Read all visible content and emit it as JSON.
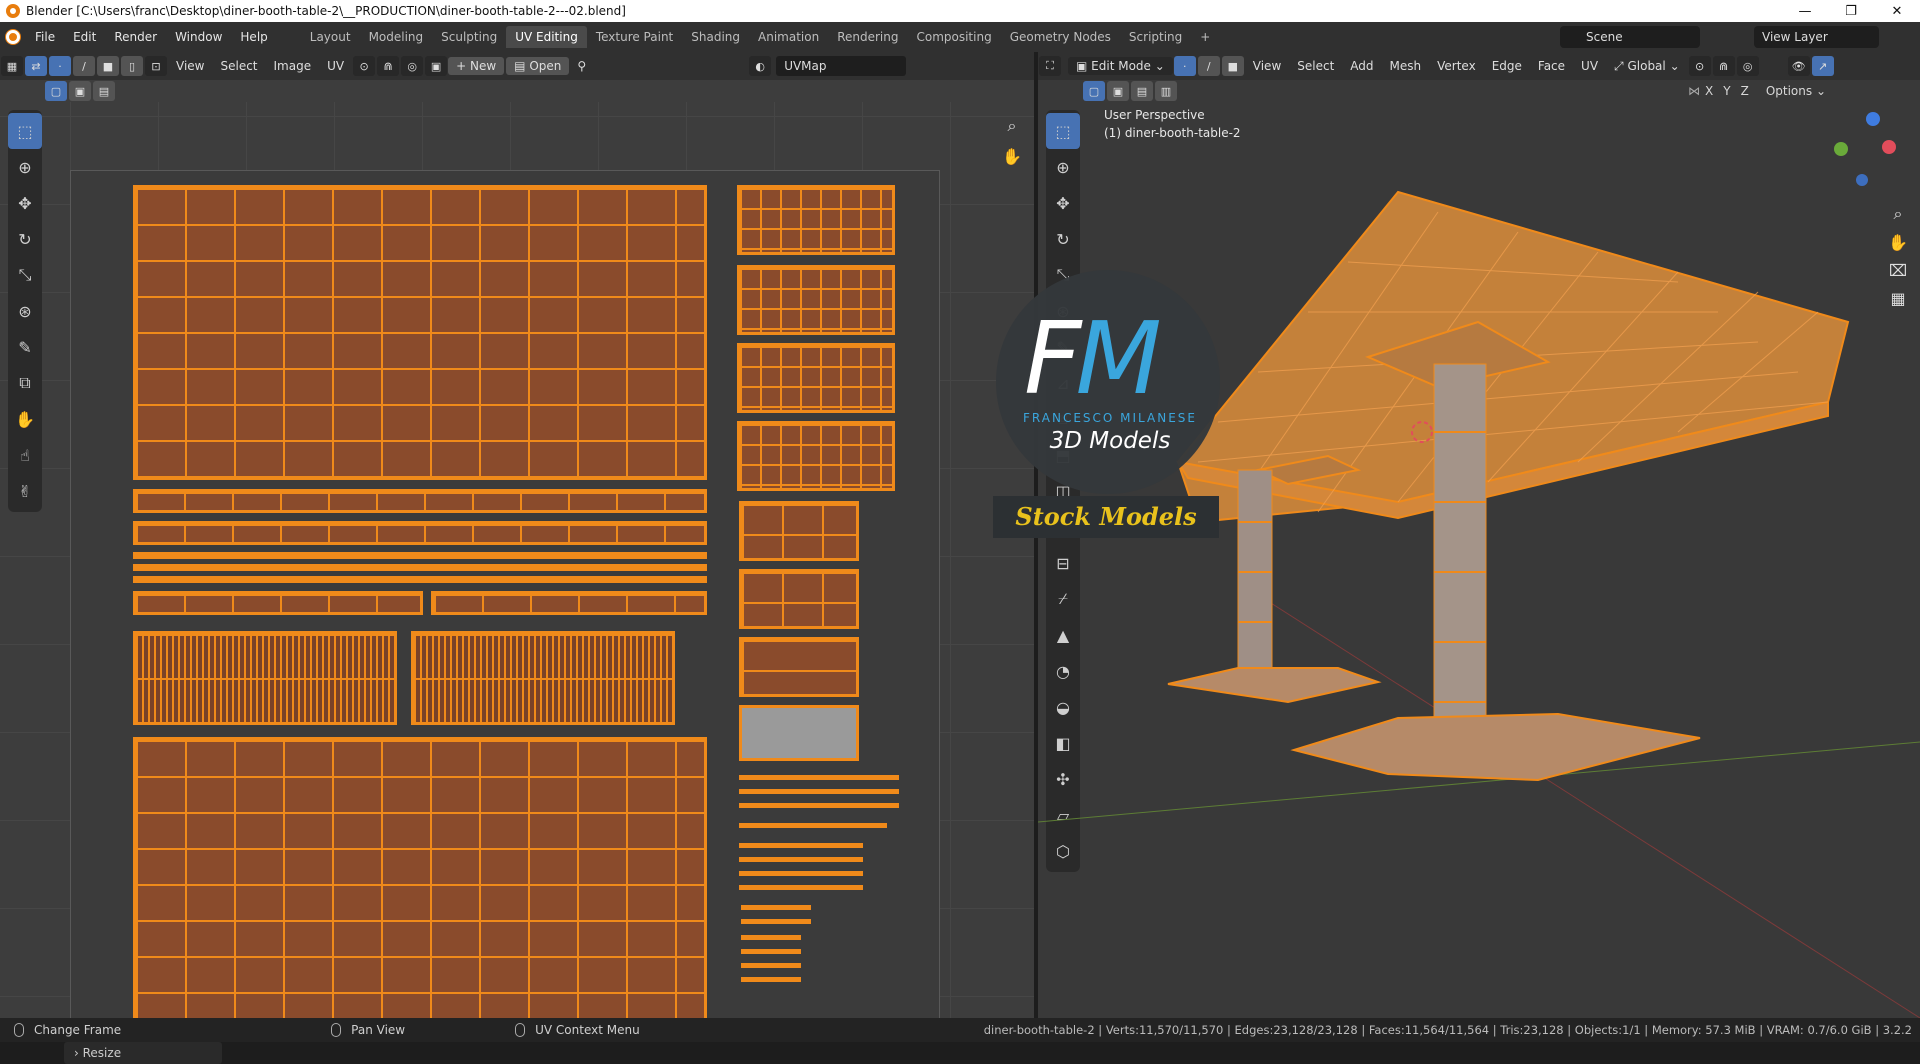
{
  "window": {
    "title": "Blender [C:\\Users\\franc\\Desktop\\diner-booth-table-2\\__PRODUCTION\\diner-booth-table-2---02.blend]",
    "min": "—",
    "max": "❐",
    "close": "✕"
  },
  "menu": [
    "File",
    "Edit",
    "Render",
    "Window",
    "Help"
  ],
  "workspaces": [
    "Layout",
    "Modeling",
    "Sculpting",
    "UV Editing",
    "Texture Paint",
    "Shading",
    "Animation",
    "Rendering",
    "Compositing",
    "Geometry Nodes",
    "Scripting"
  ],
  "active_workspace": "UV Editing",
  "scene": "Scene",
  "view_layer": "View Layer",
  "uv_editor": {
    "menus": [
      "View",
      "Select",
      "Image",
      "UV"
    ],
    "new_label": "New",
    "open_label": "Open",
    "uvmap": "UVMap",
    "resize_panel": "Resize"
  },
  "viewport": {
    "mode": "Edit Mode",
    "menus": [
      "View",
      "Select",
      "Add",
      "Mesh",
      "Vertex",
      "Edge",
      "Face",
      "UV"
    ],
    "orientation": "Global",
    "axes": [
      "X",
      "Y",
      "Z"
    ],
    "options": "Options",
    "view_name": "User Perspective",
    "object_name": "(1) diner-booth-table-2"
  },
  "watermark": {
    "f": "F",
    "m": "M",
    "author": "FRANCESCO MILANESE",
    "tagline": "3D Models",
    "stock": "Stock Models"
  },
  "status": {
    "left": "Change Frame",
    "middle": "Pan View",
    "right": "UV Context Menu",
    "stats": "diner-booth-table-2 | Verts:11,570/11,570 | Edges:23,128/23,128 | Faces:11,564/11,564 | Tris:23,128 | Objects:1/1 | Memory: 57.3 MiB | VRAM: 0.7/6.0 GiB | 3.2.2"
  },
  "colors": {
    "accent": "#4772b3",
    "selection": "#f08a1a",
    "face": "#8a4b2c"
  }
}
